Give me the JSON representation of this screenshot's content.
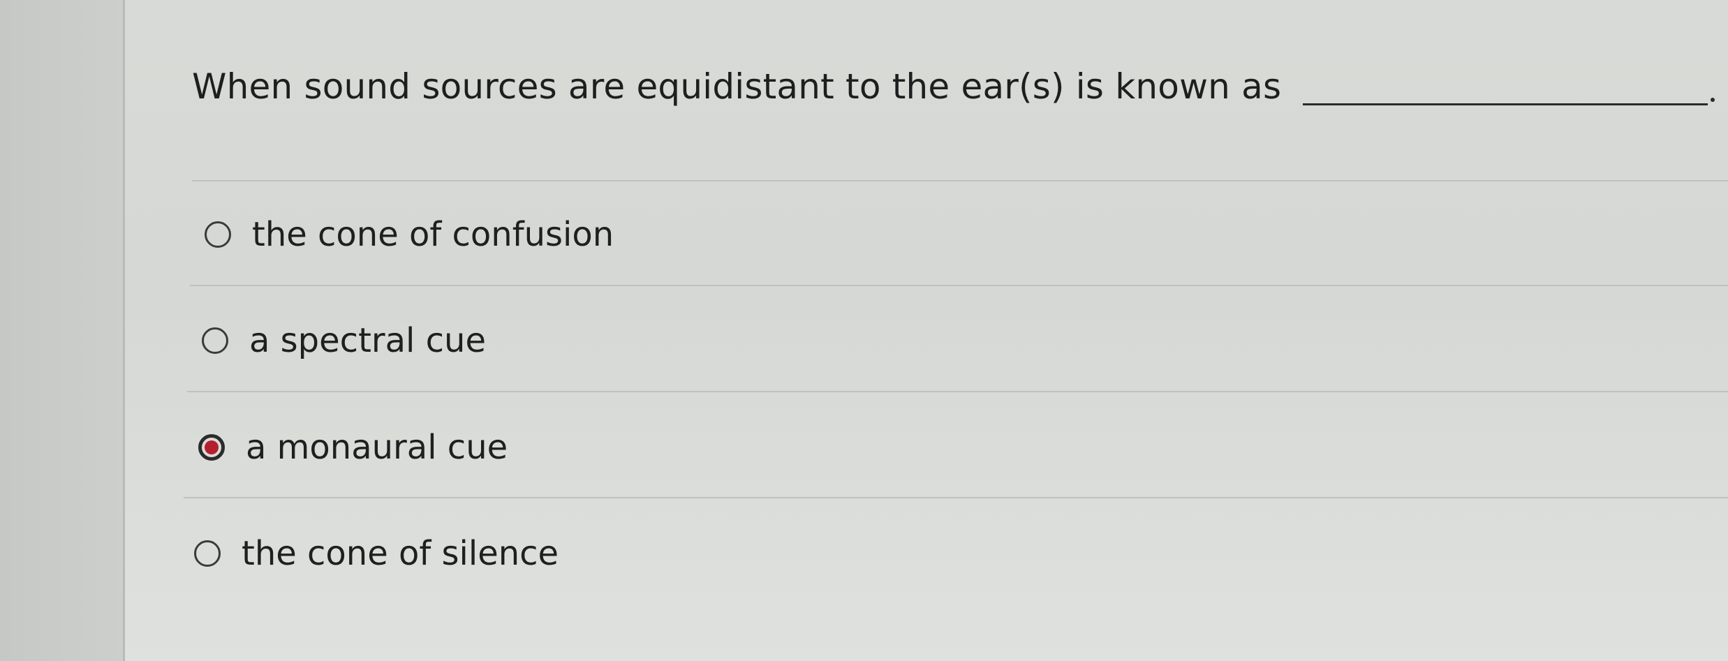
{
  "question": {
    "text": "When sound sources are equidistant to the ear(s) is known as"
  },
  "options": [
    {
      "label": "the cone of confusion",
      "selected": false
    },
    {
      "label": "a spectral cue",
      "selected": false
    },
    {
      "label": "a monaural cue",
      "selected": true
    },
    {
      "label": "the cone of silence",
      "selected": false
    }
  ],
  "colors": {
    "selected_radio": "#b5202f",
    "text": "#1f1f1f",
    "background": "#d8dad7"
  }
}
